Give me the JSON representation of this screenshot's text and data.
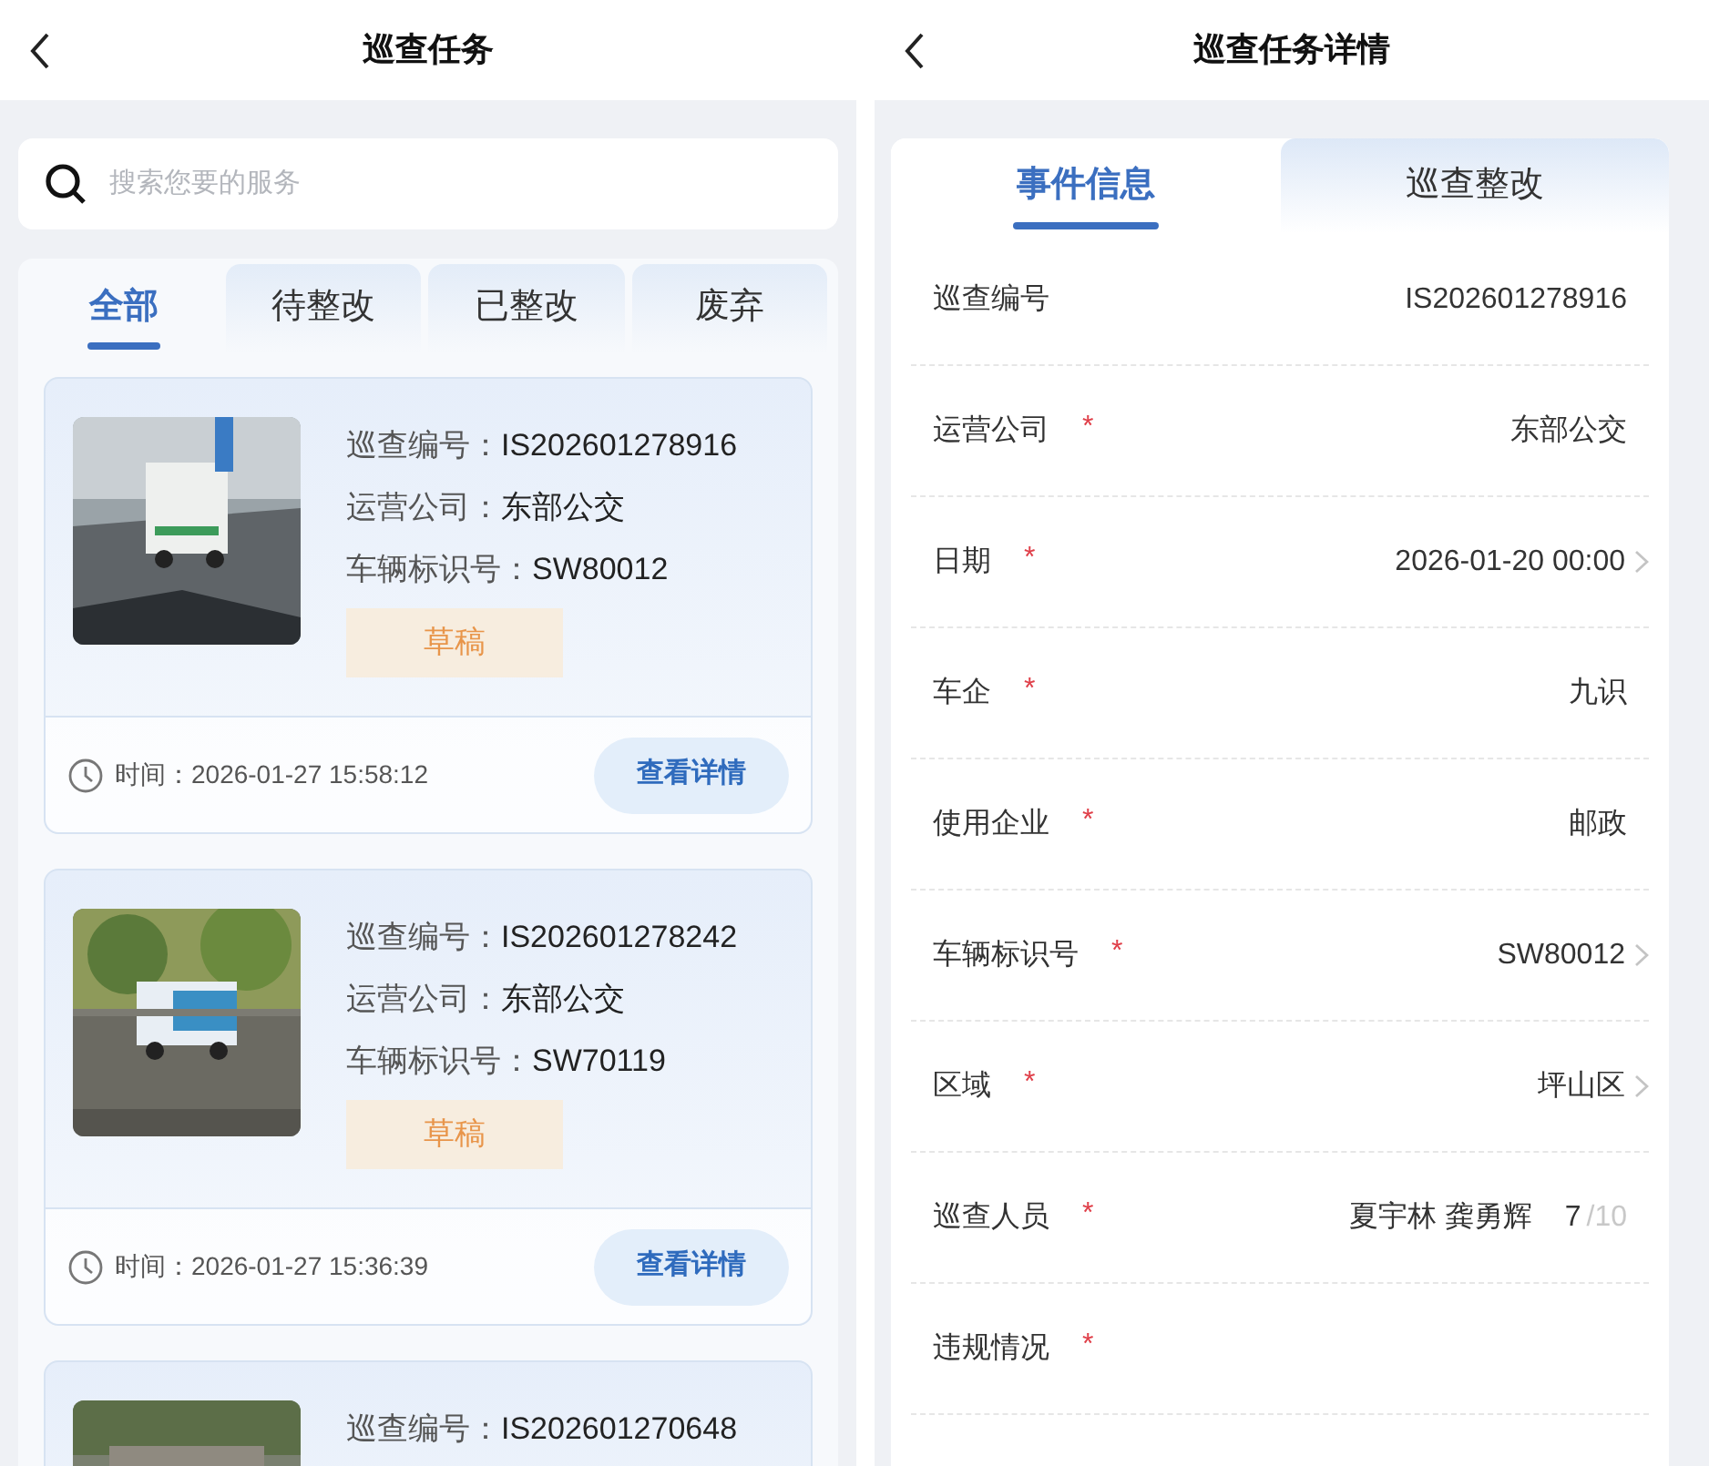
{
  "task_list": {
    "title": "巡查任务",
    "search": {
      "placeholder": "搜索您要的服务"
    },
    "tabs": [
      {
        "label": "全部",
        "selected": true
      },
      {
        "label": "待整改",
        "selected": false
      },
      {
        "label": "已整改",
        "selected": false
      },
      {
        "label": "废弃",
        "selected": false
      }
    ],
    "tasks": [
      {
        "image": {
          "kind": "picture"
        },
        "fields": [
          {
            "label": "巡查编号：",
            "value": "IS202601278916"
          },
          {
            "label": "运营公司：",
            "value": "东部公交"
          },
          {
            "label": "车辆标识号：",
            "value": "SW80012"
          }
        ],
        "status": "草稿",
        "time_label": "时间：",
        "time": "2026-01-27 15:58:12",
        "button": "查看详情"
      },
      {
        "image": {
          "kind": "picture"
        },
        "fields": [
          {
            "label": "巡查编号：",
            "value": "IS202601278242"
          },
          {
            "label": "运营公司：",
            "value": "东部公交"
          },
          {
            "label": "车辆标识号：",
            "value": "SW70119"
          }
        ],
        "status": "草稿",
        "time_label": "时间：",
        "time": "2026-01-27 15:36:39",
        "button": "查看详情"
      },
      {
        "image": {
          "kind": "picture"
        },
        "fields": [
          {
            "label": "巡查编号：",
            "value": "IS202601270648"
          }
        ]
      }
    ]
  },
  "task_detail": {
    "title": "巡查任务详情",
    "tabs": [
      {
        "label": "事件信息",
        "selected": true
      },
      {
        "label": "巡查整改",
        "selected": false
      }
    ],
    "rows": [
      {
        "label": "巡查编号",
        "value": "IS202601278916",
        "chevron": false
      },
      {
        "label": "运营公司",
        "required_mark": "*",
        "value": "东部公交",
        "chevron": false
      },
      {
        "label": "日期",
        "required_mark": "*",
        "value": "2026-01-20 00:00",
        "chevron": true
      },
      {
        "label": "车企",
        "required_mark": "*",
        "value": "九识",
        "chevron": false
      },
      {
        "label": "使用企业",
        "required_mark": "*",
        "value": "邮政",
        "chevron": false
      },
      {
        "label": "车辆标识号",
        "required_mark": "*",
        "value": "SW80012",
        "chevron": true
      },
      {
        "label": "区域",
        "required_mark": "*",
        "value": "坪山区",
        "chevron": true
      },
      {
        "label": "巡查人员",
        "required_mark": "*",
        "value": "夏宇林 龚勇辉",
        "chevron": false,
        "count": "7",
        "limit": "/10"
      },
      {
        "label": "违规情况",
        "required_mark": "*",
        "chevron": false
      }
    ]
  }
}
